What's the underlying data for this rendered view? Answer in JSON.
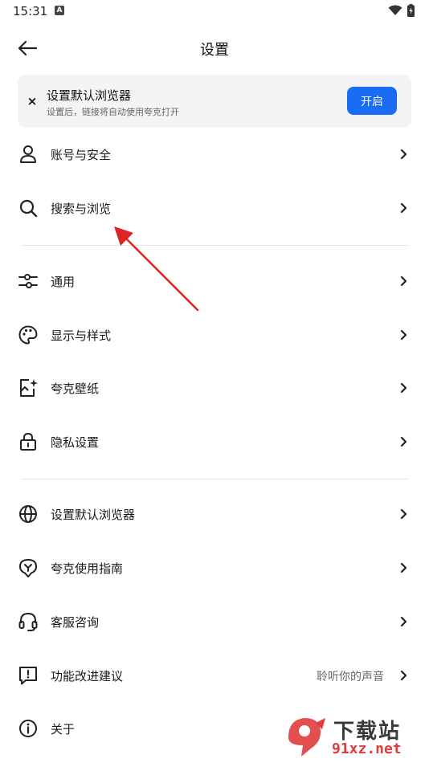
{
  "status_bar": {
    "time": "15:31",
    "notification_icon": "A"
  },
  "header": {
    "title": "设置"
  },
  "banner": {
    "title": "设置默认浏览器",
    "subtitle": "设置后，链接将自动使用夸克打开",
    "button_label": "开启",
    "accent": "#1a6cf5"
  },
  "groups": [
    {
      "items": [
        {
          "label": "账号与安全",
          "icon": "user-icon"
        },
        {
          "label": "搜索与浏览",
          "icon": "search-icon"
        }
      ]
    },
    {
      "items": [
        {
          "label": "通用",
          "icon": "sliders-icon"
        },
        {
          "label": "显示与样式",
          "icon": "palette-icon"
        },
        {
          "label": "夸克壁纸",
          "icon": "wallpaper-icon"
        },
        {
          "label": "隐私设置",
          "icon": "lock-icon"
        }
      ]
    },
    {
      "items": [
        {
          "label": "设置默认浏览器",
          "icon": "globe-icon"
        },
        {
          "label": "夸克使用指南",
          "icon": "guide-icon"
        },
        {
          "label": "客服咨询",
          "icon": "headset-icon"
        },
        {
          "label": "功能改进建议",
          "icon": "feedback-icon",
          "value": "聆听你的声音"
        },
        {
          "label": "关于",
          "icon": "info-icon"
        }
      ]
    }
  ],
  "annotation_color": "#e02424",
  "watermark": {
    "top": "下载站",
    "bottom": "91xz.net"
  }
}
